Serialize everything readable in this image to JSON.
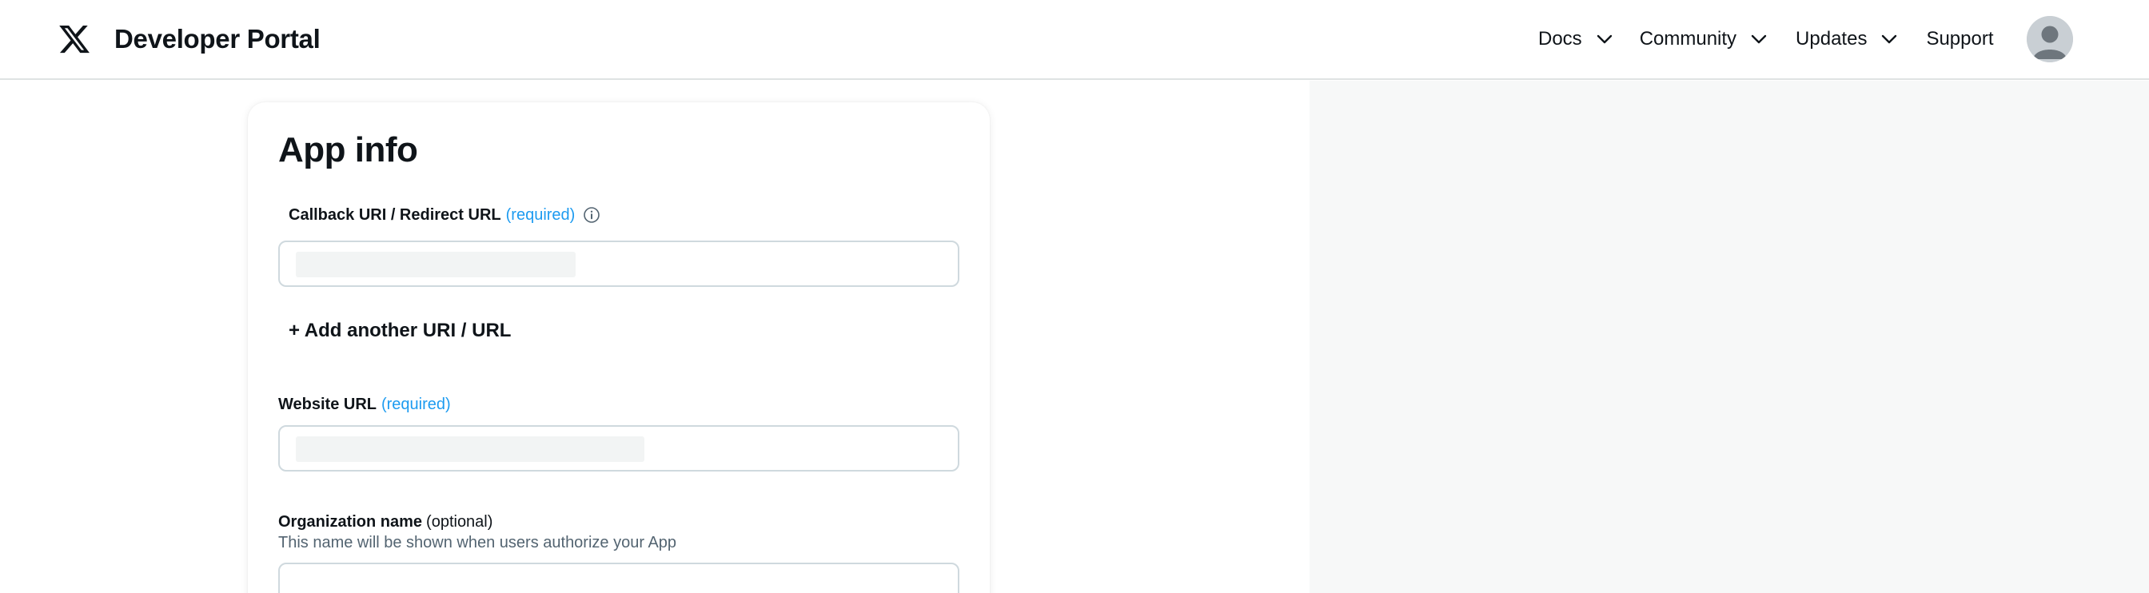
{
  "header": {
    "brand": "Developer Portal",
    "nav": [
      {
        "label": "Docs",
        "has_dropdown": true
      },
      {
        "label": "Community",
        "has_dropdown": true
      },
      {
        "label": "Updates",
        "has_dropdown": true
      },
      {
        "label": "Support",
        "has_dropdown": false
      }
    ],
    "icons": {
      "logo": "x-logo-icon",
      "avatar": "user-avatar-icon",
      "chevron": "chevron-down-icon"
    }
  },
  "card": {
    "title": "App info",
    "fields": {
      "callback": {
        "label": "Callback URI / Redirect URL",
        "qualifier": "(required)",
        "icon": "info-icon",
        "value": ""
      },
      "add_uri_label": "+ Add another URI / URL",
      "website": {
        "label": "Website URL",
        "qualifier": "(required)",
        "value": ""
      },
      "organization": {
        "label": "Organization name",
        "qualifier": "(optional)",
        "help": "This name will be shown when users authorize your App",
        "value": ""
      }
    }
  },
  "colors": {
    "required_accent": "#1d9bf0",
    "text_primary": "#0f1419",
    "text_secondary": "#536471",
    "border": "#cfd9de",
    "side_panel": "#f7f8f8"
  }
}
